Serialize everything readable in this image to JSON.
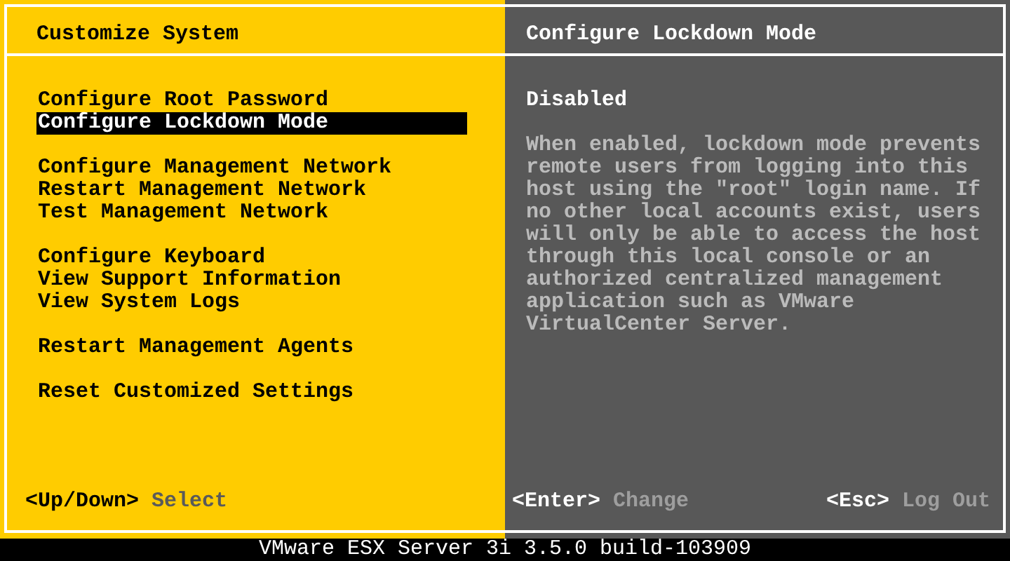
{
  "left_panel": {
    "title": "Customize System",
    "menu_groups": [
      {
        "items": [
          {
            "label": "Configure Root Password",
            "selected": false
          },
          {
            "label": "Configure Lockdown Mode",
            "selected": true
          }
        ]
      },
      {
        "items": [
          {
            "label": "Configure Management Network",
            "selected": false
          },
          {
            "label": "Restart Management Network",
            "selected": false
          },
          {
            "label": "Test Management Network",
            "selected": false
          }
        ]
      },
      {
        "items": [
          {
            "label": "Configure Keyboard",
            "selected": false
          },
          {
            "label": "View Support Information",
            "selected": false
          },
          {
            "label": "View System Logs",
            "selected": false
          }
        ]
      },
      {
        "items": [
          {
            "label": "Restart Management Agents",
            "selected": false
          }
        ]
      },
      {
        "items": [
          {
            "label": "Reset Customized Settings",
            "selected": false
          }
        ]
      }
    ],
    "hints": [
      {
        "key": "<Up/Down>",
        "action": "Select"
      }
    ]
  },
  "right_panel": {
    "title": "Configure Lockdown Mode",
    "status": "Disabled",
    "description": "When enabled, lockdown mode prevents remote users from logging into this host using the \"root\" login name. If no other local accounts exist, users will only be able to access the host through this local console or an authorized centralized management application such as VMware VirtualCenter Server.",
    "hints": [
      {
        "key": "<Enter>",
        "action": "Change"
      },
      {
        "key": "<Esc>",
        "action": "Log Out"
      }
    ]
  },
  "status_bar": "VMware ESX Server 3i 3.5.0 build-103909"
}
